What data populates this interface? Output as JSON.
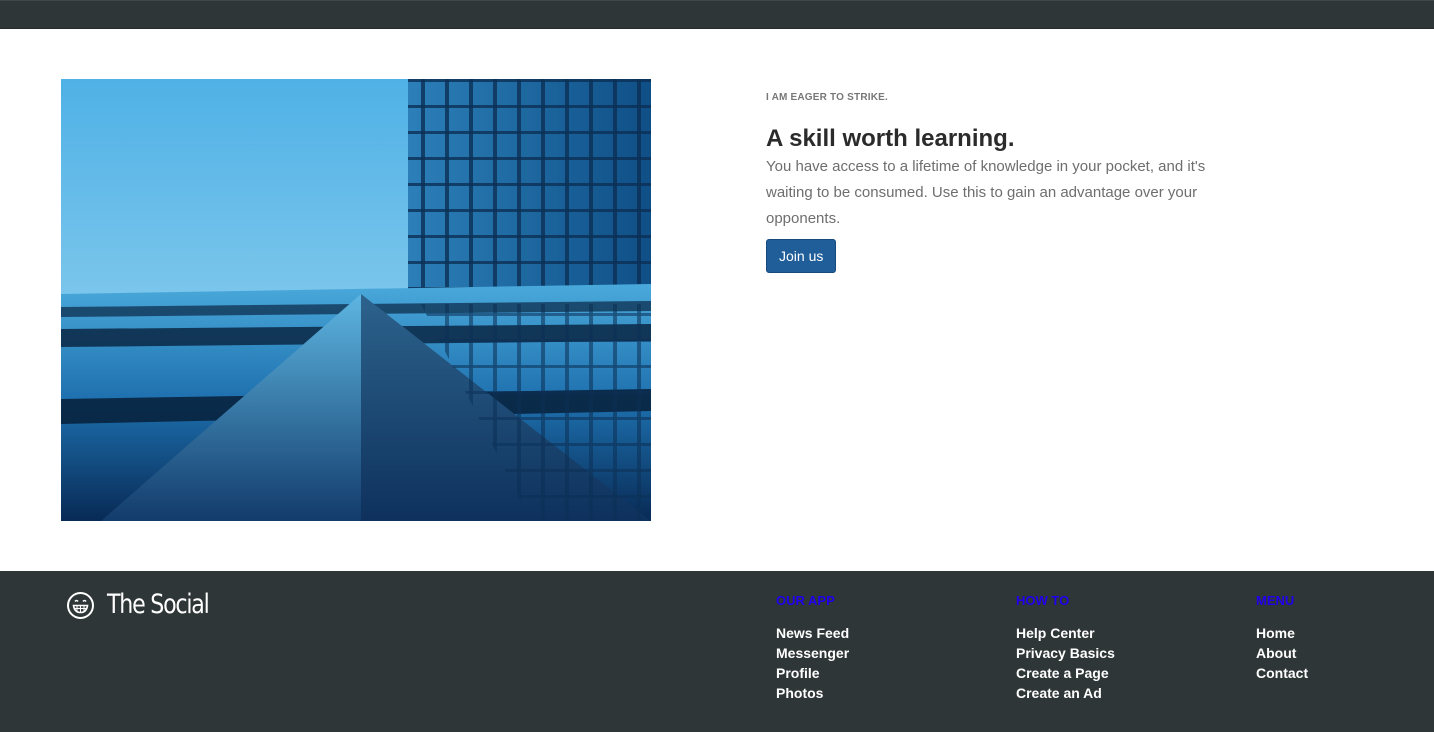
{
  "hero": {
    "eyebrow": "I AM EAGER TO STRIKE.",
    "headline": "A skill worth learning.",
    "body": "You have access to a lifetime of knowledge in your pocket, and it's waiting to be consumed. Use this to gain an advantage over your opponents.",
    "button_label": "Join us",
    "image_icon": "building-photo"
  },
  "footer": {
    "brand": {
      "name": "The Social",
      "icon": "grin-face-icon"
    },
    "columns": [
      {
        "heading": "OUR APP",
        "links": [
          "News Feed",
          "Messenger",
          "Profile",
          "Photos"
        ]
      },
      {
        "heading": "HOW TO",
        "links": [
          "Help Center",
          "Privacy Basics",
          "Create a Page",
          "Create an Ad"
        ]
      },
      {
        "heading": "MENU",
        "links": [
          "Home",
          "About",
          "Contact"
        ]
      }
    ]
  },
  "colors": {
    "bar": "#2f3637",
    "accent": "#1f5e99",
    "footer_heading": "#2200ee"
  }
}
